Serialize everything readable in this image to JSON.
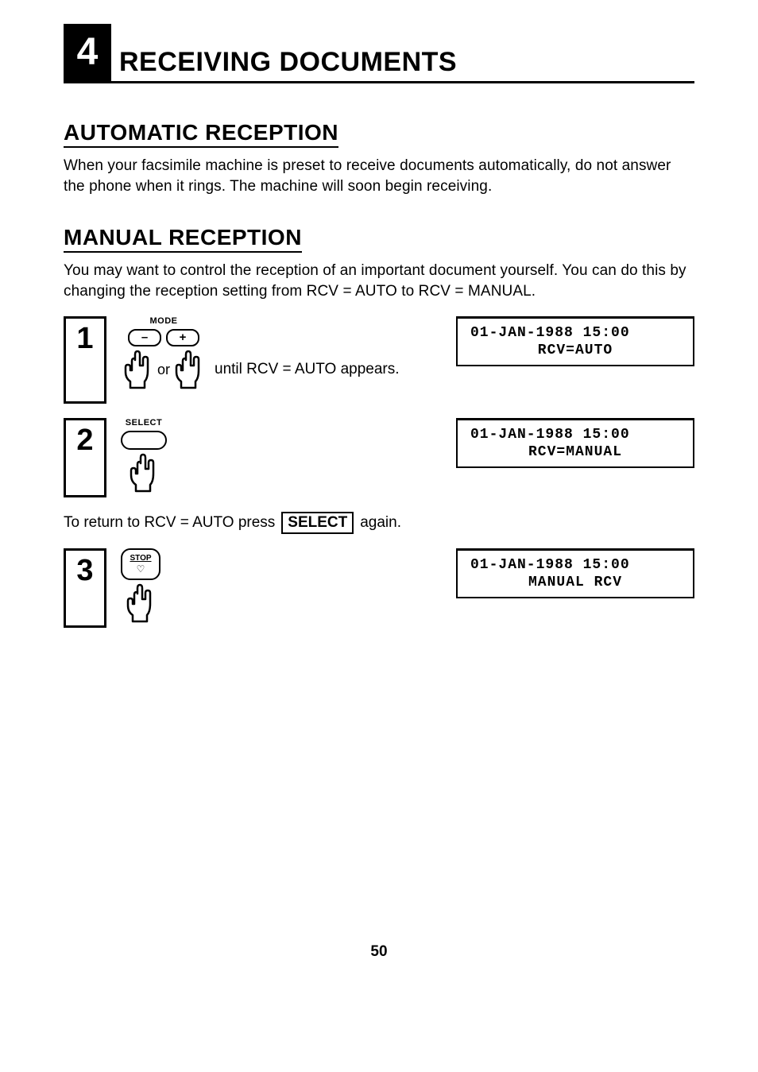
{
  "chapter": {
    "number": "4",
    "title": "RECEIVING DOCUMENTS"
  },
  "sections": {
    "auto": {
      "title": "AUTOMATIC RECEPTION",
      "body": "When your facsimile machine is preset to receive documents automatically, do not answer the phone when it rings. The machine will soon begin receiving."
    },
    "manual": {
      "title": "MANUAL RECEPTION",
      "body": "You may want to control the reception of an important document yourself. You can do this by changing the reception setting from RCV = AUTO to RCV = MANUAL."
    }
  },
  "steps": [
    {
      "num": "1",
      "mode_label": "MODE",
      "minus": "–",
      "plus": "+",
      "or": "or",
      "until": "until RCV = AUTO appears.",
      "display_line1": "01-JAN-1988  15:00",
      "display_line2": "RCV=AUTO"
    },
    {
      "num": "2",
      "select_label": "SELECT",
      "display_line1": "01-JAN-1988  15:00",
      "display_line2": "RCV=MANUAL"
    },
    {
      "num": "3",
      "stop_label": "STOP",
      "display_line1": "01-JAN-1988  15:00",
      "display_line2": "MANUAL  RCV"
    }
  ],
  "note": {
    "prefix": "To return to RCV = AUTO press",
    "button": "SELECT",
    "suffix": "again."
  },
  "page_number": "50"
}
